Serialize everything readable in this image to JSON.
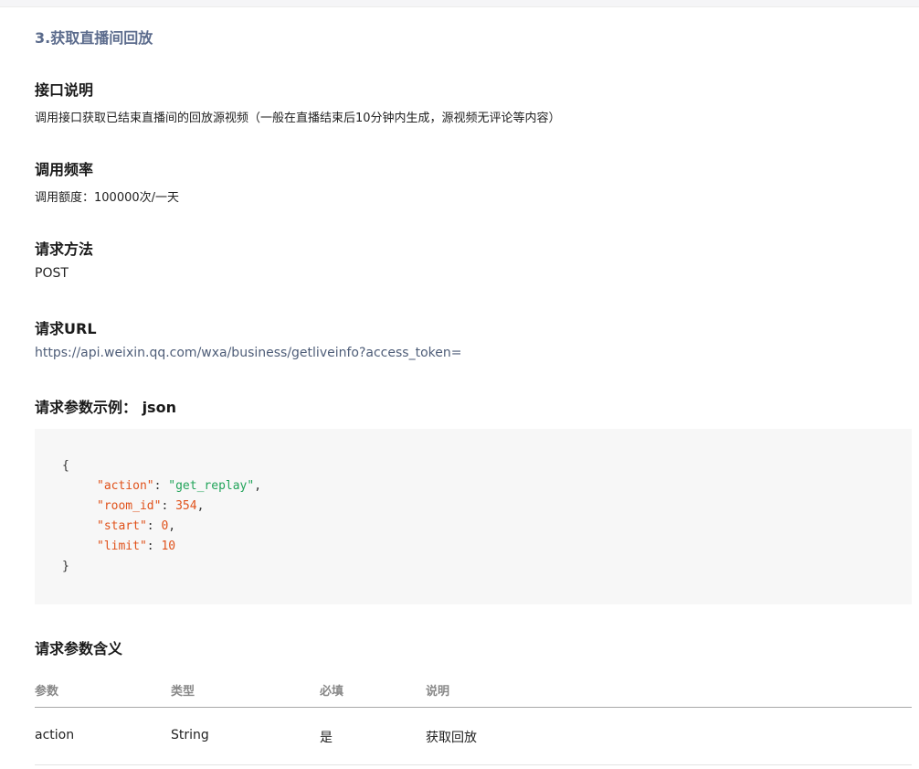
{
  "section": {
    "title": "3.获取直播间回放"
  },
  "intro": {
    "heading": "接口说明",
    "text": "调用接口获取已结束直播间的回放源视频（一般在直播结束后10分钟内生成，源视频无评论等内容）"
  },
  "rate": {
    "heading": "调用频率",
    "text": "调用额度：100000次/一天"
  },
  "method": {
    "heading": "请求方法",
    "value": "POST"
  },
  "url": {
    "heading": "请求URL",
    "value": "https://api.weixin.qq.com/wxa/business/getliveinfo?access_token="
  },
  "example": {
    "heading": "请求参数示例： json",
    "open_brace": "{",
    "close_brace": "}",
    "lines": [
      {
        "key": "\"action\"",
        "value": "\"get_replay\"",
        "value_type": "string",
        "trail": ","
      },
      {
        "key": "\"room_id\"",
        "value": "354",
        "value_type": "number",
        "trail": ","
      },
      {
        "key": "\"start\"",
        "value": "0",
        "value_type": "number",
        "trail": ","
      },
      {
        "key": "\"limit\"",
        "value": "10",
        "value_type": "number",
        "trail": ""
      }
    ]
  },
  "params": {
    "heading": "请求参数含义",
    "columns": [
      "参数",
      "类型",
      "必填",
      "说明"
    ],
    "rows": [
      [
        "action",
        "String",
        "是",
        "获取回放"
      ]
    ]
  },
  "colors": {
    "title": "#5b6b8c",
    "link": "#4e5d78",
    "code_key": "#e0521b",
    "code_string": "#22a45a",
    "code_bg": "#f7f7f7"
  }
}
